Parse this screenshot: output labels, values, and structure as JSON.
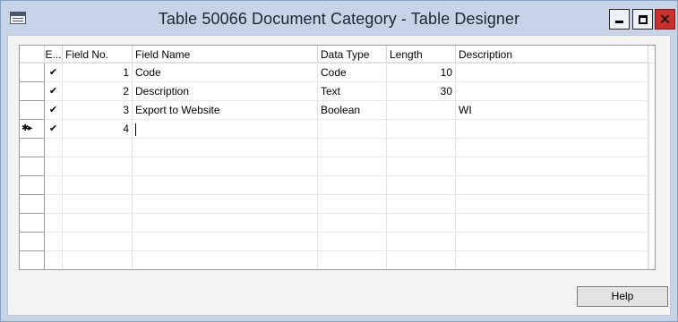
{
  "window": {
    "title": "Table 50066 Document Category - Table Designer"
  },
  "grid": {
    "columns": {
      "enabled": "E...",
      "field_no": "Field No.",
      "field_name": "Field Name",
      "data_type": "Data Type",
      "length": "Length",
      "description": "Description"
    },
    "rows": [
      {
        "enabled": "✔",
        "field_no": "1",
        "field_name": "Code",
        "data_type": "Code",
        "length": "10",
        "description": ""
      },
      {
        "enabled": "✔",
        "field_no": "2",
        "field_name": "Description",
        "data_type": "Text",
        "length": "30",
        "description": ""
      },
      {
        "enabled": "✔",
        "field_no": "3",
        "field_name": "Export to Website",
        "data_type": "Boolean",
        "length": "",
        "description": "WI"
      },
      {
        "enabled": "✔",
        "field_no": "4",
        "field_name": "",
        "data_type": "",
        "length": "",
        "description": ""
      }
    ],
    "current_row_indicator": "✱▸",
    "scroll_up": "∧",
    "scroll_down": "∨"
  },
  "footer": {
    "help_label": "Help"
  },
  "icons": {
    "app": "table-designer-icon",
    "minimize": "minimize-icon",
    "maximize": "maximize-icon",
    "close": "close-icon"
  },
  "colors": {
    "titlebar": "#c7d3e6",
    "close_button": "#c9302c",
    "content_bg": "#f3f3f3"
  }
}
